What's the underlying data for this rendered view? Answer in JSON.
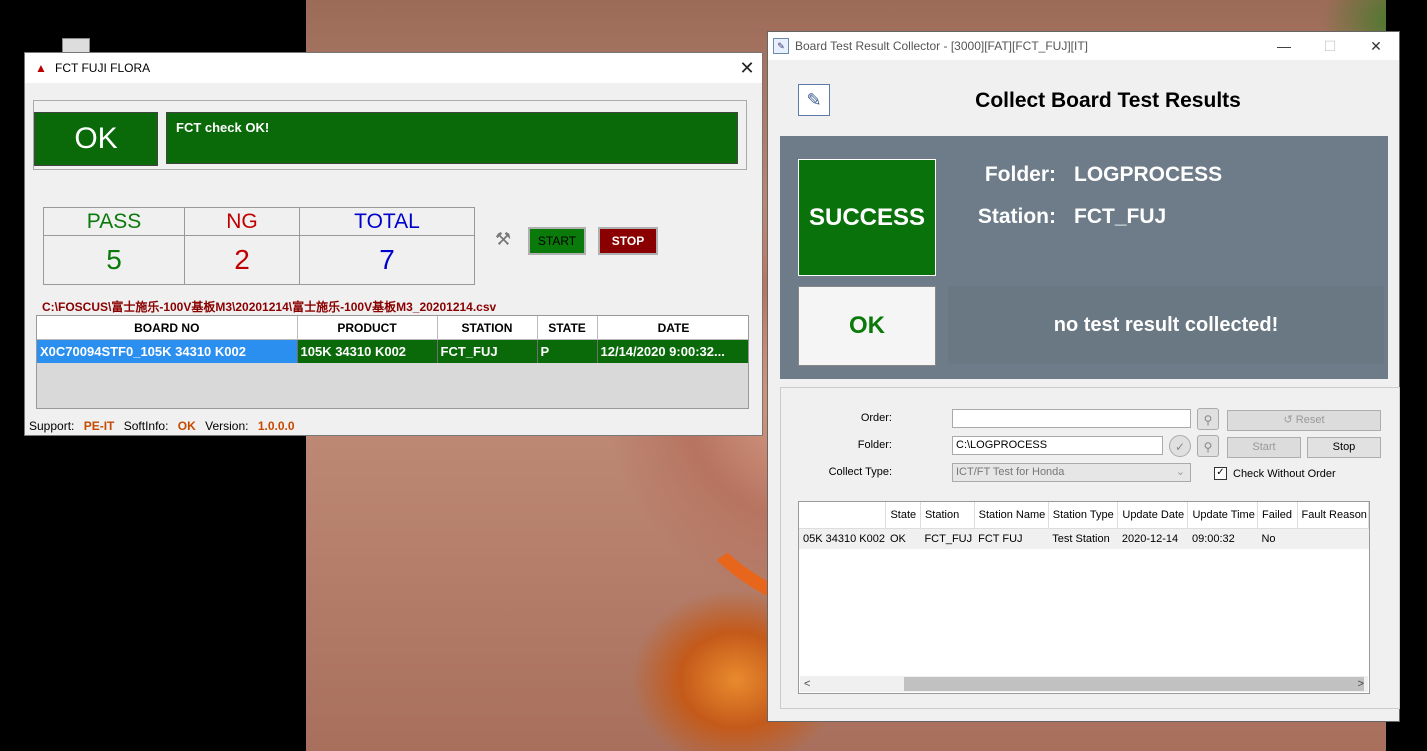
{
  "fct": {
    "title": "FCT FUJI FLORA",
    "result": "OK",
    "message": "FCT check OK!",
    "counts": {
      "pass_label": "PASS",
      "ng_label": "NG",
      "total_label": "TOTAL",
      "pass": "5",
      "ng": "2",
      "total": "7"
    },
    "start_label": "START",
    "stop_label": "STOP",
    "csv_path": "C:\\FOSCUS\\富士施乐-100V基板M3\\20201214\\富士施乐-100V基板M3_20201214.csv",
    "grid": {
      "headers": [
        "BOARD NO",
        "PRODUCT",
        "STATION",
        "STATE",
        "DATE"
      ],
      "rows": [
        [
          "X0C70094STF0_105K 34310 K002",
          "105K 34310 K002",
          "FCT_FUJ",
          "P",
          "12/14/2020 9:00:32..."
        ]
      ]
    },
    "status": {
      "support_label": "Support:",
      "support": "PE-IT",
      "softinfo_label": "SoftInfo:",
      "softinfo": "OK",
      "version_label": "Version:",
      "version": "1.0.0.0"
    }
  },
  "collector": {
    "title": "Board Test Result Collector - [3000][FAT][FCT_FUJ][IT]",
    "header": "Collect Board Test Results",
    "result": "SUCCESS",
    "folder_label": "Folder:",
    "folder": "LOGPROCESS",
    "station_label": "Station:",
    "station": "FCT_FUJ",
    "status_ok": "OK",
    "note": "no test result collected!",
    "form": {
      "order_label": "Order:",
      "order_value": "",
      "folder_label": "Folder:",
      "folder_value": "C:\\LOGPROCESS",
      "collect_type_label": "Collect Type:",
      "collect_type_value": "ICT/FT Test for Honda",
      "reset_label": "Reset",
      "start_label": "Start",
      "stop_label": "Stop",
      "check_without_order": "Check Without Order",
      "check_without_order_checked": true
    },
    "grid": {
      "headers": [
        "",
        "State",
        "Station",
        "Station Name",
        "Station Type",
        "Update Date",
        "Update Time",
        "Failed",
        "Fault Reason"
      ],
      "rows": [
        [
          "05K 34310 K002",
          "OK",
          "FCT_FUJ",
          "FCT FUJ",
          "Test Station",
          "2020-12-14",
          "09:00:32",
          "No",
          ""
        ]
      ]
    }
  },
  "colors": {
    "ok_green": "#0a6a0a",
    "stop_red": "#8a0000",
    "select_blue": "#2b8ff0",
    "panel_slate": "#6d7c88",
    "pass": "#0a7a0a",
    "ng": "#c00000",
    "total": "#0000cc"
  }
}
